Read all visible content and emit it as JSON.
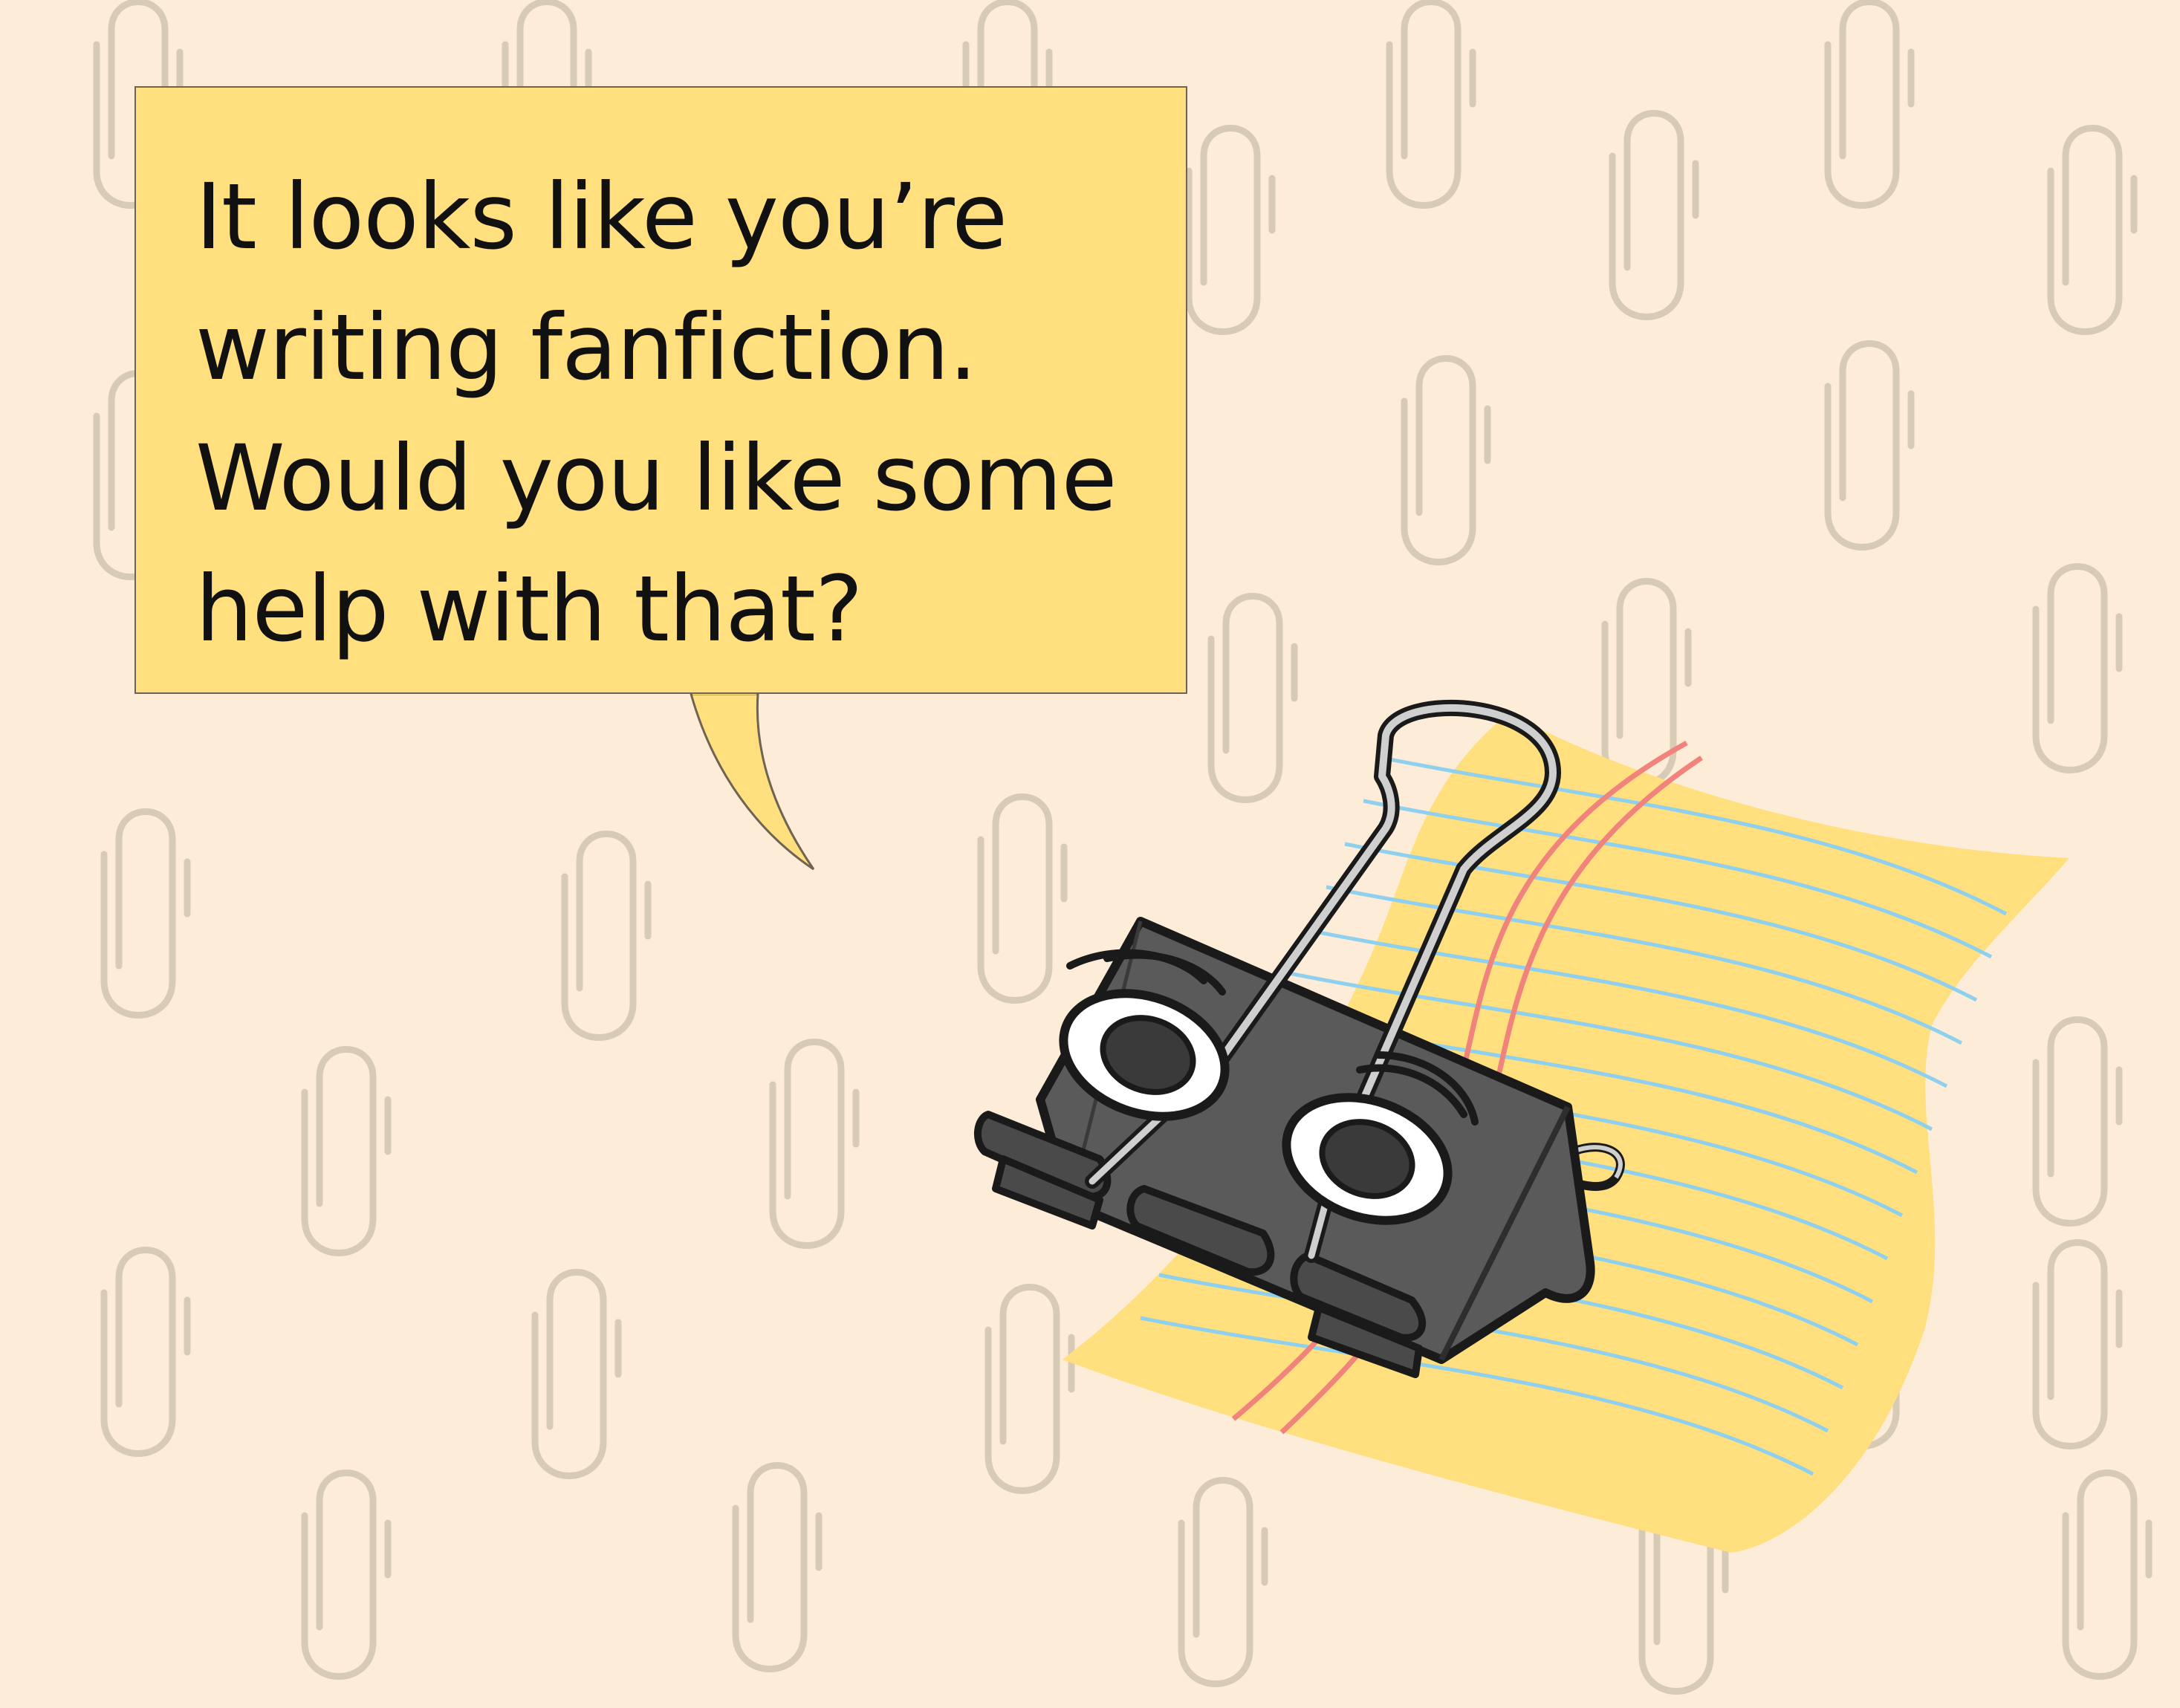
{
  "speech_bubble": {
    "lines": [
      "It looks like you’re",
      "writing fanfiction.",
      "Would you like some",
      "help with that?"
    ]
  },
  "icons": {
    "background_pattern": "paperclip-icon",
    "character": "binder-clip-character",
    "paper": "legal-pad-paper"
  },
  "colors": {
    "background": "#fdecd7",
    "paperclip_pattern": "#d8cbb6",
    "bubble_fill": "#ffdf7e",
    "paper_fill": "#ffdf7e",
    "paper_ruling": "#8fd0ee",
    "paper_margin": "#f0837b",
    "clip_body": "#5a5a5a",
    "clip_handle": "#cfcfcf"
  }
}
